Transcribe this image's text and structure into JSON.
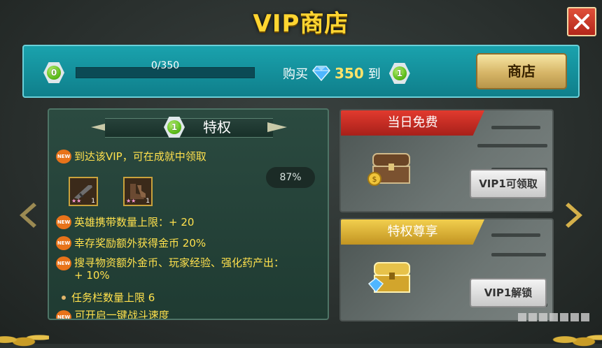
{
  "title": "VIP商店",
  "top_bar": {
    "current_vip_level": "0",
    "progress_text": "0/350",
    "progress_fraction": 0,
    "buy_prefix": "购买",
    "buy_amount": "350",
    "buy_suffix": "到",
    "target_vip_level": "1",
    "shop_button_label": "商店"
  },
  "privilege_panel": {
    "level": "1",
    "title": "特权",
    "new_badge": "NEW",
    "rows": [
      "到达该VIP，可在成就中领取",
      "英雄携带数量上限：+ 20",
      "幸存奖励额外获得金币 20%",
      "搜寻物资额外金币、玩家经验、强化药产出：",
      "+ 10%",
      "任务栏数量上限 6",
      "可开启一键战斗速度"
    ],
    "percent": "87%",
    "items": [
      {
        "icon": "rifle-item-icon",
        "count": "1"
      },
      {
        "icon": "boots-item-icon",
        "count": "1"
      }
    ]
  },
  "cards": [
    {
      "tab": "当日免费",
      "button": "VIP1可领取",
      "chest": "wooden-chest-icon",
      "accent": "#d4302a"
    },
    {
      "tab": "特权尊享",
      "button": "VIP1解锁",
      "chest": "golden-chest-icon",
      "accent": "#e2b93a"
    }
  ],
  "colors": {
    "title": "#ffd531",
    "highlight": "#ffe14d",
    "teal": "#1aa2ad"
  }
}
